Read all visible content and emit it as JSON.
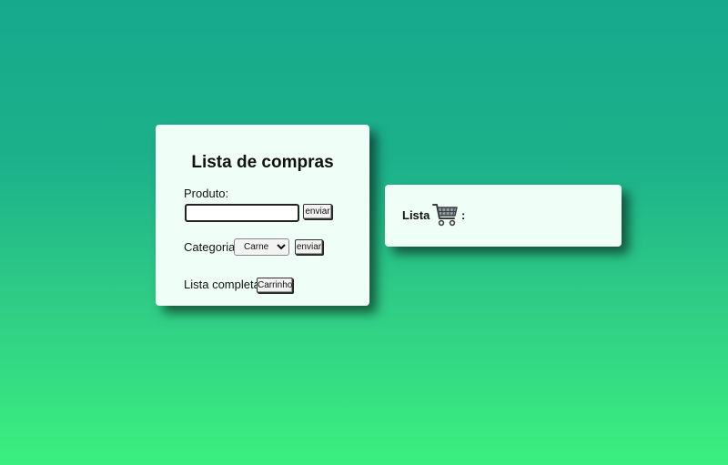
{
  "form": {
    "title": "Lista de compras",
    "produto_label": "Produto:",
    "produto_value": "",
    "produto_submit": "enviar",
    "categoria_label": "Categoria:",
    "categoria_selected": "Carne",
    "categoria_submit": "enviar",
    "lista_completa_label": "Lista completa:",
    "carrinho_button": "Carrinho"
  },
  "list_panel": {
    "label": "Lista",
    "icon": "shopping-cart-icon",
    "separator": ":"
  },
  "colors": {
    "background_top": "#17a98c",
    "background_bottom": "#3bf07f",
    "card_background": "#effff7"
  }
}
